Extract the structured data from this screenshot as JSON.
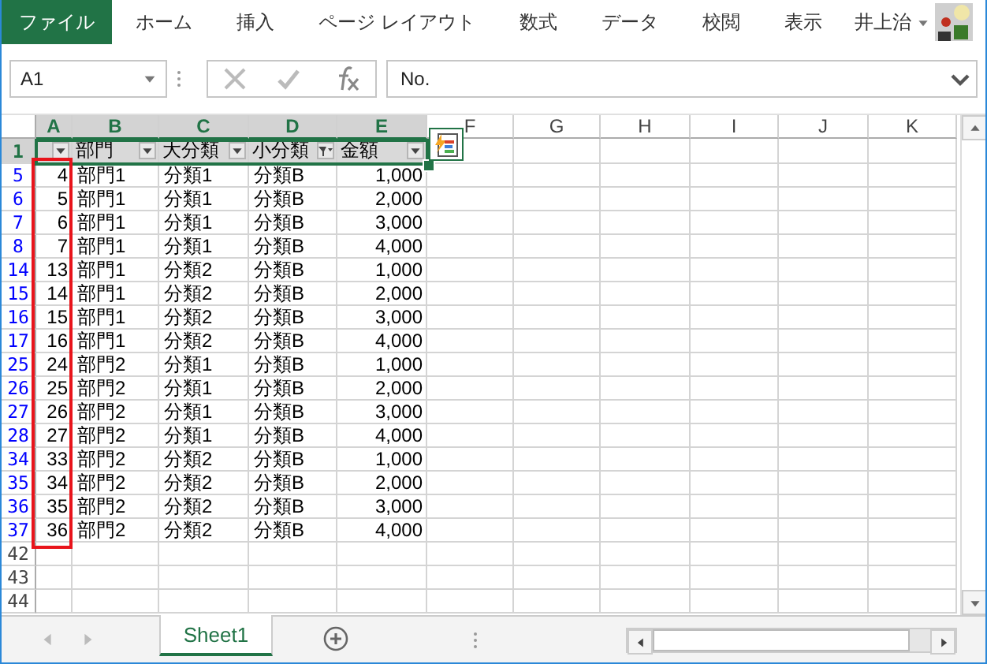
{
  "ribbon_tabs": [
    {
      "label": "ファイル",
      "selected": true
    },
    {
      "label": "ホーム",
      "selected": false
    },
    {
      "label": "挿入",
      "selected": false
    },
    {
      "label": "ページ レイアウト",
      "selected": false
    },
    {
      "label": "数式",
      "selected": false
    },
    {
      "label": "データ",
      "selected": false
    },
    {
      "label": "校閲",
      "selected": false
    },
    {
      "label": "表示",
      "selected": false
    }
  ],
  "user": {
    "name": "井上治"
  },
  "formula_bar": {
    "name_box": "A1",
    "formula": "No."
  },
  "columns": [
    {
      "label": "A",
      "selected": true
    },
    {
      "label": "B",
      "selected": true
    },
    {
      "label": "C",
      "selected": true
    },
    {
      "label": "D",
      "selected": true
    },
    {
      "label": "E",
      "selected": true
    },
    {
      "label": "F",
      "selected": false
    },
    {
      "label": "G",
      "selected": false
    },
    {
      "label": "H",
      "selected": false
    },
    {
      "label": "I",
      "selected": false
    },
    {
      "label": "J",
      "selected": false
    },
    {
      "label": "K",
      "selected": false
    }
  ],
  "header_row": {
    "row": "1",
    "selected": true,
    "cells": [
      {
        "text": "",
        "filtered": false
      },
      {
        "text": "部門",
        "filtered": false
      },
      {
        "text": "大分類",
        "filtered": false
      },
      {
        "text": "小分類",
        "filtered": true
      },
      {
        "text": "金額",
        "filtered": false
      }
    ]
  },
  "rows": [
    {
      "row": "5",
      "filtered": true,
      "cells": [
        "4",
        "部門1",
        "分類1",
        "分類B",
        "1,000"
      ]
    },
    {
      "row": "6",
      "filtered": true,
      "cells": [
        "5",
        "部門1",
        "分類1",
        "分類B",
        "2,000"
      ]
    },
    {
      "row": "7",
      "filtered": true,
      "cells": [
        "6",
        "部門1",
        "分類1",
        "分類B",
        "3,000"
      ]
    },
    {
      "row": "8",
      "filtered": true,
      "cells": [
        "7",
        "部門1",
        "分類1",
        "分類B",
        "4,000"
      ]
    },
    {
      "row": "14",
      "filtered": true,
      "cells": [
        "13",
        "部門1",
        "分類2",
        "分類B",
        "1,000"
      ]
    },
    {
      "row": "15",
      "filtered": true,
      "cells": [
        "14",
        "部門1",
        "分類2",
        "分類B",
        "2,000"
      ]
    },
    {
      "row": "16",
      "filtered": true,
      "cells": [
        "15",
        "部門1",
        "分類2",
        "分類B",
        "3,000"
      ]
    },
    {
      "row": "17",
      "filtered": true,
      "cells": [
        "16",
        "部門1",
        "分類2",
        "分類B",
        "4,000"
      ]
    },
    {
      "row": "25",
      "filtered": true,
      "cells": [
        "24",
        "部門2",
        "分類1",
        "分類B",
        "1,000"
      ]
    },
    {
      "row": "26",
      "filtered": true,
      "cells": [
        "25",
        "部門2",
        "分類1",
        "分類B",
        "2,000"
      ]
    },
    {
      "row": "27",
      "filtered": true,
      "cells": [
        "26",
        "部門2",
        "分類1",
        "分類B",
        "3,000"
      ]
    },
    {
      "row": "28",
      "filtered": true,
      "cells": [
        "27",
        "部門2",
        "分類1",
        "分類B",
        "4,000"
      ]
    },
    {
      "row": "34",
      "filtered": true,
      "cells": [
        "33",
        "部門2",
        "分類2",
        "分類B",
        "1,000"
      ]
    },
    {
      "row": "35",
      "filtered": true,
      "cells": [
        "34",
        "部門2",
        "分類2",
        "分類B",
        "2,000"
      ]
    },
    {
      "row": "36",
      "filtered": true,
      "cells": [
        "35",
        "部門2",
        "分類2",
        "分類B",
        "3,000"
      ]
    },
    {
      "row": "37",
      "filtered": true,
      "cells": [
        "36",
        "部門2",
        "分類2",
        "分類B",
        "4,000"
      ]
    },
    {
      "row": "42",
      "filtered": false,
      "cells": []
    },
    {
      "row": "43",
      "filtered": false,
      "cells": []
    },
    {
      "row": "44",
      "filtered": false,
      "cells": []
    }
  ],
  "sheet_tabs": [
    {
      "label": "Sheet1",
      "selected": true
    }
  ]
}
